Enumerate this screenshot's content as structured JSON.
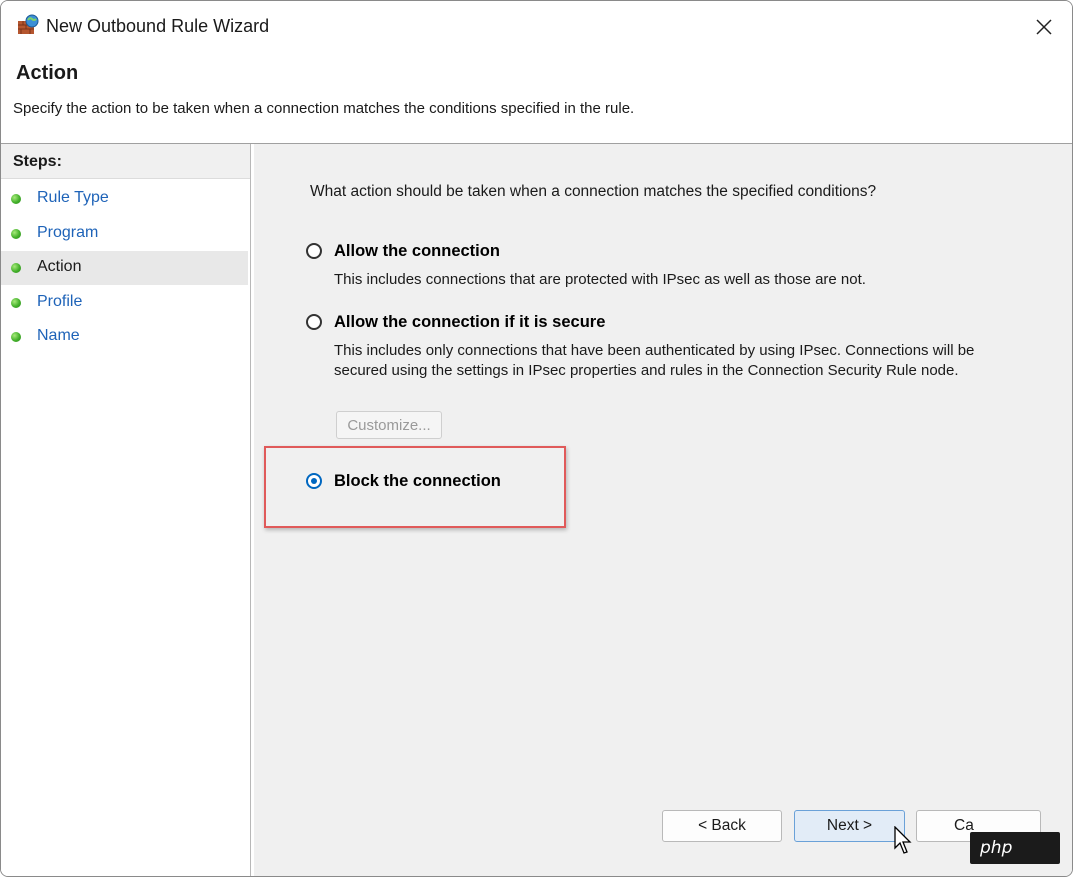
{
  "window": {
    "title": "New Outbound Rule Wizard",
    "icon": "firewall-icon",
    "close_icon": "close-icon"
  },
  "header": {
    "title": "Action",
    "subtitle": "Specify the action to be taken when a connection matches the conditions specified in the rule."
  },
  "steps": {
    "heading": "Steps:",
    "items": [
      {
        "label": "Rule Type",
        "state": "link"
      },
      {
        "label": "Program",
        "state": "link"
      },
      {
        "label": "Action",
        "state": "current"
      },
      {
        "label": "Profile",
        "state": "link"
      },
      {
        "label": "Name",
        "state": "link"
      }
    ]
  },
  "main": {
    "question": "What action should be taken when a connection matches the specified conditions?",
    "options": [
      {
        "label": "Allow the connection",
        "checked": false,
        "description": "This includes connections that are protected with IPsec as well as those are not."
      },
      {
        "label": "Allow the connection if it is secure",
        "checked": false,
        "description": "This includes only connections that have been authenticated by using IPsec.  Connections will be secured using the settings in IPsec properties and rules in the Connection Security Rule node."
      },
      {
        "label": "Block the connection",
        "checked": true,
        "description": ""
      }
    ],
    "customize_label": "Customize...",
    "highlight_color": "#e05a5a"
  },
  "buttons": {
    "back": "< Back",
    "next": "Next >",
    "cancel": "Ca"
  },
  "watermark": "php",
  "colors": {
    "link": "#1e63b8",
    "radio_accent": "#0067c0",
    "step_dot": "#43b02a"
  }
}
